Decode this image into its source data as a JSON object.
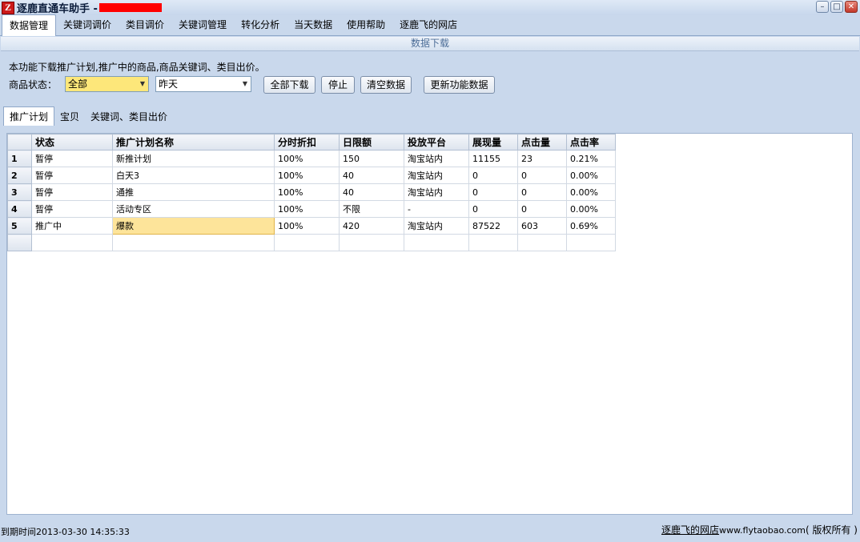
{
  "window": {
    "title": "逐鹿直通车助手 -",
    "icon": "Z"
  },
  "menu": [
    {
      "label": "数据管理",
      "active": true
    },
    {
      "label": "关键词调价"
    },
    {
      "label": "类目调价"
    },
    {
      "label": "关键词管理"
    },
    {
      "label": "转化分析"
    },
    {
      "label": "当天数据"
    },
    {
      "label": "使用帮助"
    },
    {
      "label": "逐鹿飞的网店"
    }
  ],
  "section_title": "数据下载",
  "panel": {
    "description": "本功能下载推广计划,推广中的商品,商品关键词、类目出价。",
    "status_label": "商品状态：",
    "status_value": "全部",
    "date_value": "昨天",
    "buttons": {
      "download_all": "全部下载",
      "stop": "停止",
      "clear": "清空数据",
      "update": "更新功能数据"
    }
  },
  "subtabs": [
    {
      "label": "推广计划",
      "active": true
    },
    {
      "label": "宝贝"
    },
    {
      "label": "关键词、类目出价"
    }
  ],
  "table": {
    "headers": [
      "状态",
      "推广计划名称",
      "分时折扣",
      "日限额",
      "投放平台",
      "展现量",
      "点击量",
      "点击率"
    ],
    "rows": [
      [
        "1",
        "暂停",
        "新推计划",
        "100%",
        "150",
        "淘宝站内",
        "11155",
        "23",
        "0.21%"
      ],
      [
        "2",
        "暂停",
        "白天3",
        "100%",
        "40",
        "淘宝站内",
        "0",
        "0",
        "0.00%"
      ],
      [
        "3",
        "暂停",
        "通推",
        "100%",
        "40",
        "淘宝站内",
        "0",
        "0",
        "0.00%"
      ],
      [
        "4",
        "暂停",
        "活动专区",
        "100%",
        "不限",
        "-",
        "0",
        "0",
        "0.00%"
      ],
      [
        "5",
        "推广中",
        "爆款",
        "100%",
        "420",
        "淘宝站内",
        "87522",
        "603",
        "0.69%"
      ]
    ]
  },
  "status": {
    "expiry": "到期时间2013-03-30 14:35:33",
    "shop_link": "逐鹿飞的网店",
    "site": "www.flytaobao.com",
    "copyright": "( 版权所有 )"
  }
}
